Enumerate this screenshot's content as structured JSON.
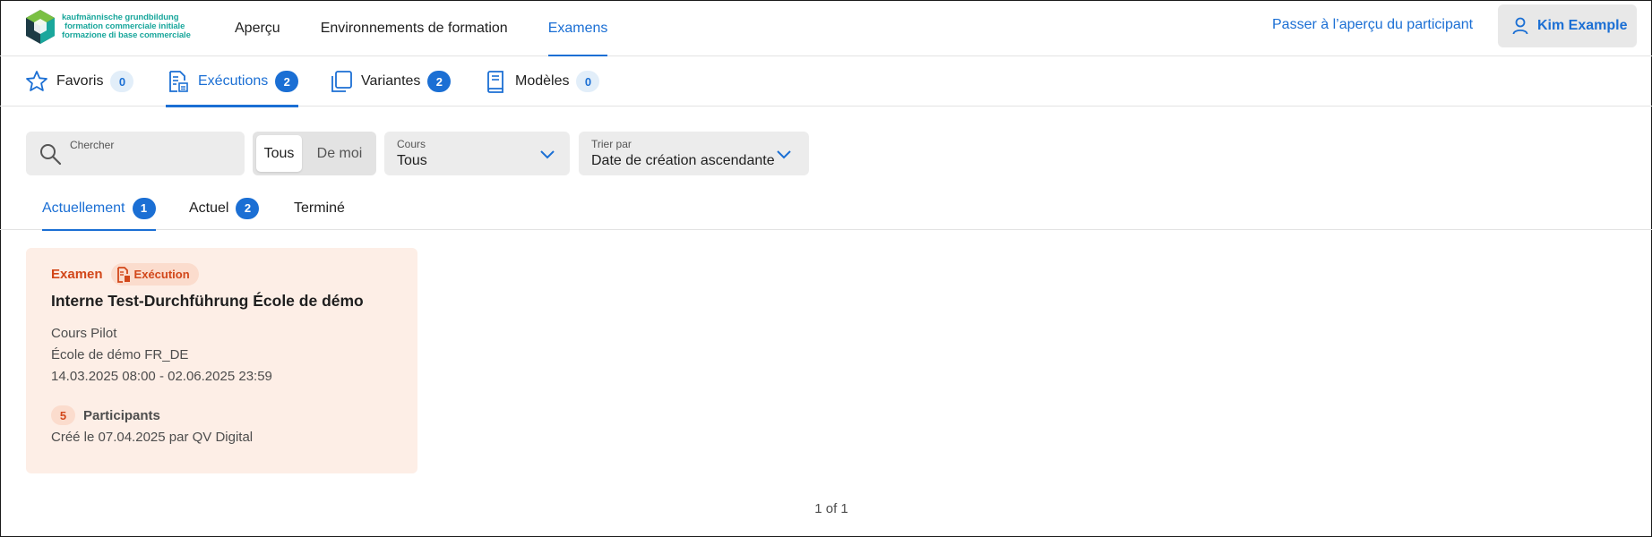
{
  "brand": {
    "line1": "kaufmännische grundbildung",
    "line2": "formation commerciale initiale",
    "line3": "formazione di base commerciale",
    "colors": {
      "teal": "#1aa79c",
      "dark": "#1d3b45",
      "green": "#7ac043"
    }
  },
  "topnav": {
    "items": [
      {
        "label": "Aperçu"
      },
      {
        "label": "Environnements de formation"
      },
      {
        "label": "Examens"
      }
    ],
    "participant_link": "Passer à l’aperçu du participant",
    "user": {
      "name": "Kim Example",
      "icon": "user-icon"
    }
  },
  "tabs": [
    {
      "label": "Favoris",
      "count": "0",
      "icon": "star-icon"
    },
    {
      "label": "Exécutions",
      "count": "2",
      "icon": "execution-icon"
    },
    {
      "label": "Variantes",
      "count": "2",
      "icon": "variants-icon"
    },
    {
      "label": "Modèles",
      "count": "0",
      "icon": "book-icon"
    }
  ],
  "filters": {
    "search_label": "Chercher",
    "toggle": {
      "all": "Tous",
      "mine": "De moi"
    },
    "course": {
      "label": "Cours",
      "value": "Tous"
    },
    "sort": {
      "label": "Trier par",
      "value": "Date de création ascendante"
    }
  },
  "status_tabs": [
    {
      "label": "Actuellement",
      "count": "1"
    },
    {
      "label": "Actuel",
      "count": "2"
    },
    {
      "label": "Terminé"
    }
  ],
  "card": {
    "kind": "Examen",
    "chip": "Exécution",
    "title": "Interne Test-Durchführung École de démo",
    "course": "Cours Pilot",
    "school": "École de démo FR_DE",
    "period": "14.03.2025 08:00 - 02.06.2025 23:59",
    "participants_count": "5",
    "participants_label": "Participants",
    "created": "Créé le 07.04.2025 par QV Digital"
  },
  "pager": "1 of 1",
  "colors": {
    "accent": "#1b6fd4",
    "exam": "#d2471a",
    "card_bg": "#fdeee6"
  }
}
